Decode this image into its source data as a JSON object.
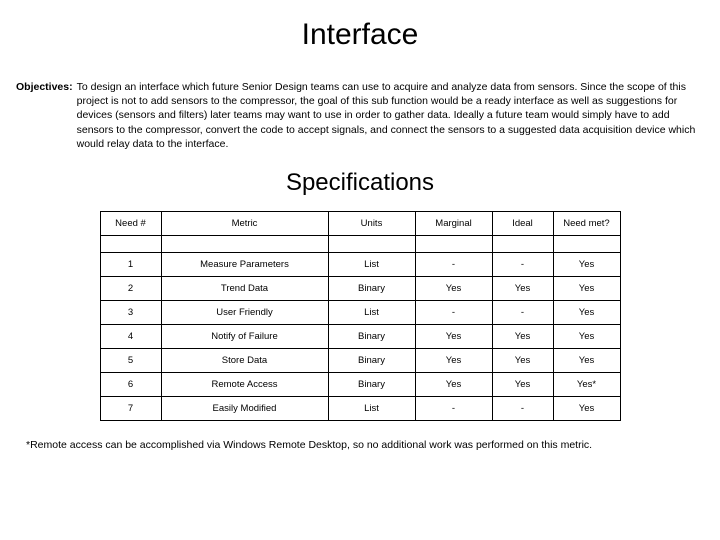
{
  "title": "Interface",
  "objectives": {
    "label": "Objectives:",
    "text": "To design an interface which future Senior Design teams can use to acquire and analyze data from sensors. Since the scope of this project is not to add sensors to the compressor, the goal of this sub function would be a ready interface as well as suggestions for devices (sensors and filters) later teams may want to use in order to gather data. Ideally a future team would simply have to add sensors to the compressor, convert the code to accept signals, and connect the sensors to a suggested data acquisition device which would relay data to the interface."
  },
  "subtitle": "Specifications",
  "table": {
    "headers": {
      "need_no": "Need #",
      "metric": "Metric",
      "units": "Units",
      "marginal": "Marginal",
      "ideal": "Ideal",
      "need_met": "Need met?"
    },
    "rows": [
      {
        "need_no": "1",
        "metric": "Measure Parameters",
        "units": "List",
        "marginal": "-",
        "ideal": "-",
        "need_met": "Yes"
      },
      {
        "need_no": "2",
        "metric": "Trend Data",
        "units": "Binary",
        "marginal": "Yes",
        "ideal": "Yes",
        "need_met": "Yes"
      },
      {
        "need_no": "3",
        "metric": "User Friendly",
        "units": "List",
        "marginal": "-",
        "ideal": "-",
        "need_met": "Yes"
      },
      {
        "need_no": "4",
        "metric": "Notify of Failure",
        "units": "Binary",
        "marginal": "Yes",
        "ideal": "Yes",
        "need_met": "Yes"
      },
      {
        "need_no": "5",
        "metric": "Store Data",
        "units": "Binary",
        "marginal": "Yes",
        "ideal": "Yes",
        "need_met": "Yes"
      },
      {
        "need_no": "6",
        "metric": "Remote Access",
        "units": "Binary",
        "marginal": "Yes",
        "ideal": "Yes",
        "need_met": "Yes*"
      },
      {
        "need_no": "7",
        "metric": "Easily Modified",
        "units": "List",
        "marginal": "-",
        "ideal": "-",
        "need_met": "Yes"
      }
    ]
  },
  "footnote": "*Remote access can be accomplished via Windows Remote Desktop, so no additional work was performed on this metric."
}
